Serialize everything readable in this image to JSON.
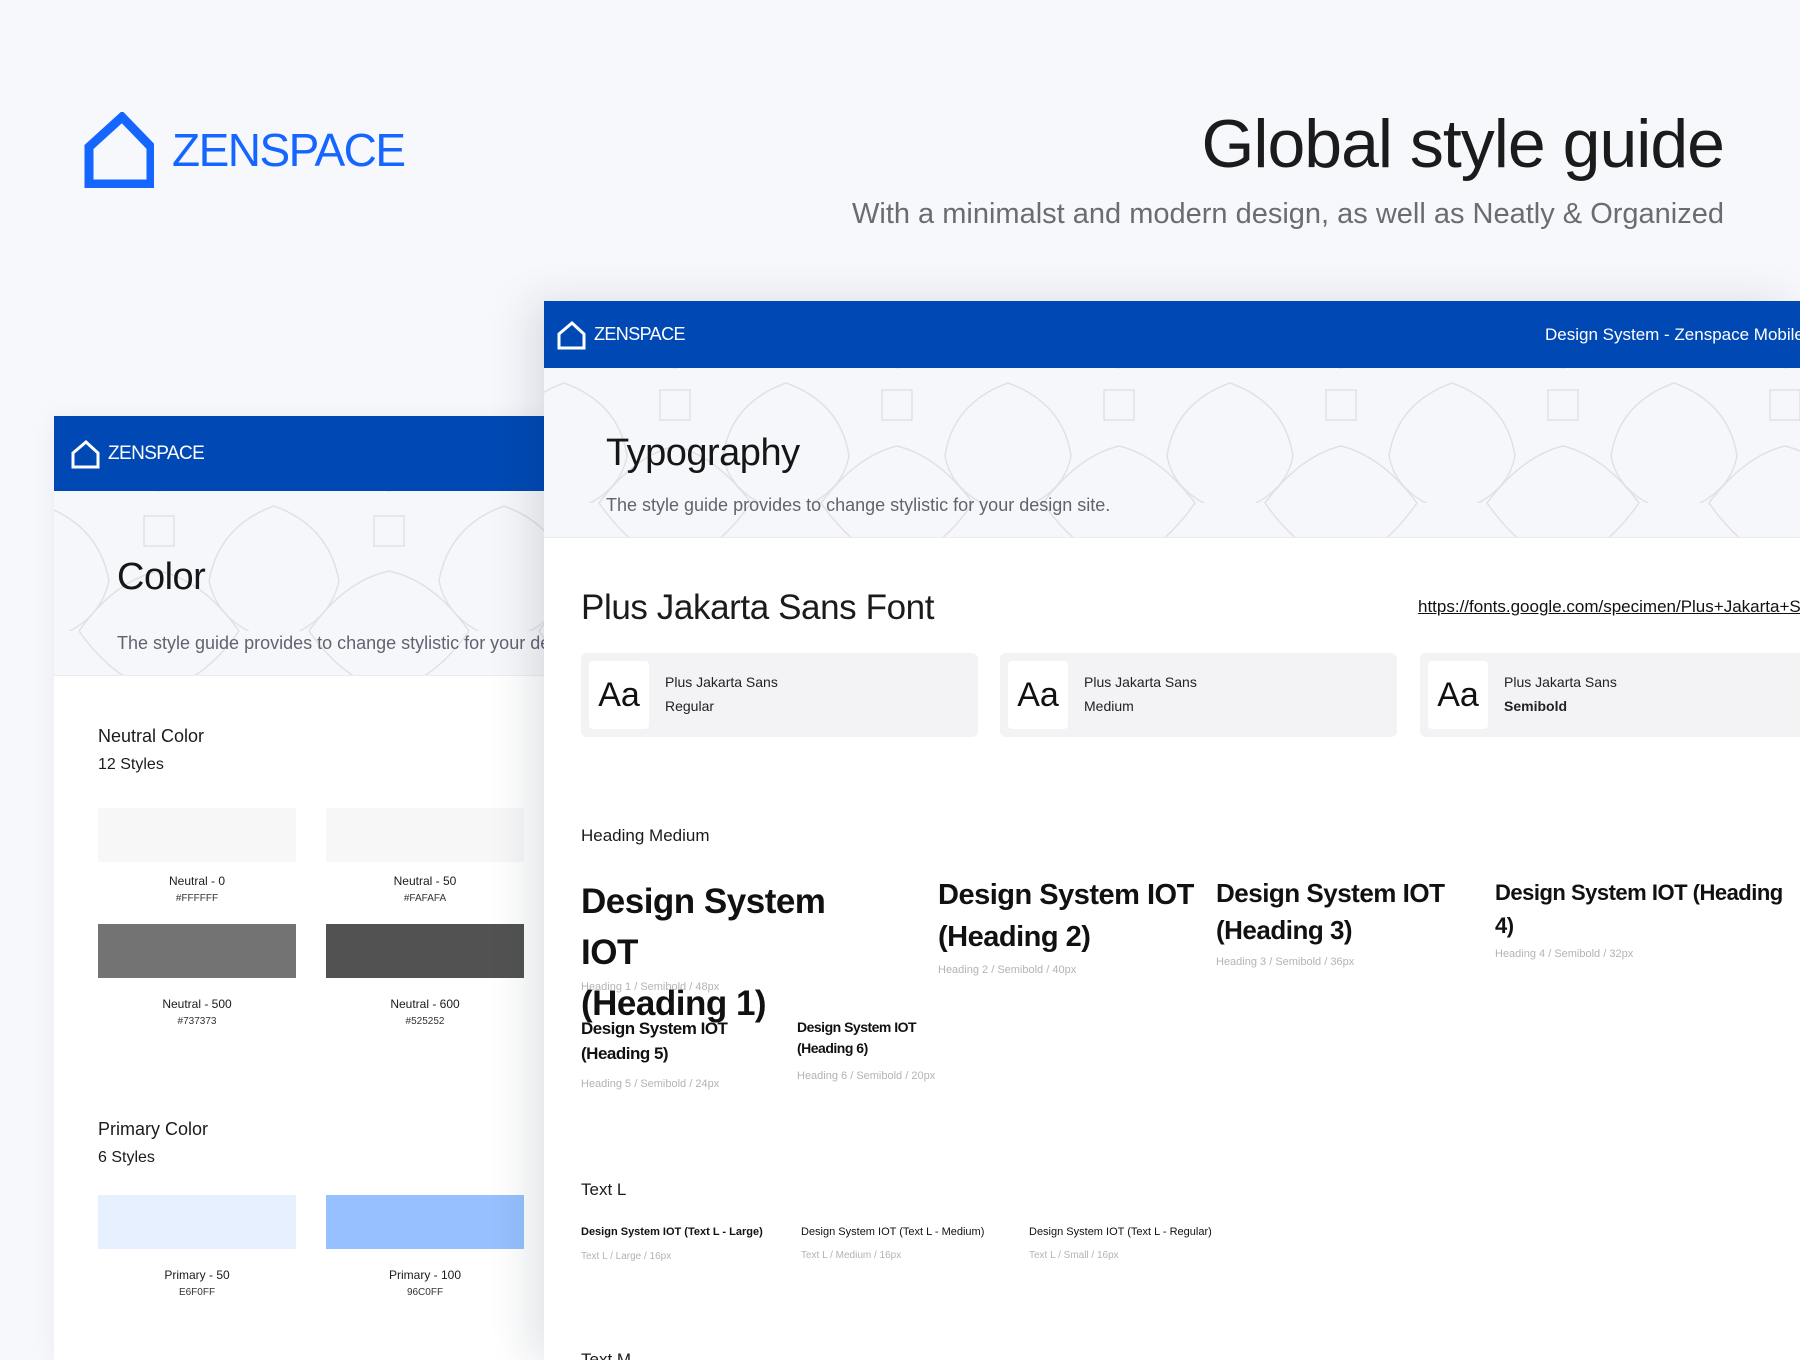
{
  "hero": {
    "brand": "ZENSPACE",
    "title": "Global style guide",
    "subtitle": "With a minimalst and modern design, as well as Neatly & Organized",
    "brand_color": "#1565ff"
  },
  "color_card": {
    "brand": "ZENSPACE",
    "title": "Color",
    "subtitle": "The style guide provides to change stylistic for your design site.",
    "neutral": {
      "title": "Neutral Color",
      "count": "12 Styles",
      "swatches": [
        {
          "name": "Neutral - 0",
          "hex": "#FFFFFF",
          "color": "#f7f7f8"
        },
        {
          "name": "Neutral - 50",
          "hex": "#FAFAFA",
          "color": "#f7f7f8"
        },
        {
          "name": "Neutral - 500",
          "hex": "#737373",
          "color": "#737373"
        },
        {
          "name": "Neutral - 600",
          "hex": "#525252",
          "color": "#525252"
        }
      ]
    },
    "primary": {
      "title": "Primary Color",
      "count": "6 Styles",
      "swatches": [
        {
          "name": "Primary - 50",
          "hex": "E6F0FF",
          "color": "#e6f0ff"
        },
        {
          "name": "Primary - 100",
          "hex": "96C0FF",
          "color": "#96c0ff"
        }
      ]
    }
  },
  "typo_card": {
    "brand": "ZENSPACE",
    "header_right": "Design System - Zenspace Mobile",
    "bar_color": "#0049b4",
    "title": "Typography",
    "subtitle": "The style guide provides to change stylistic for your design site.",
    "font_title": "Plus Jakarta Sans Font",
    "font_link": "https://fonts.google.com/specimen/Plus+Jakarta+Sans",
    "fonts": [
      {
        "aa": "Aa",
        "name": "Plus Jakarta Sans",
        "weight": "Regular"
      },
      {
        "aa": "Aa",
        "name": "Plus Jakarta Sans",
        "weight": "Medium"
      },
      {
        "aa": "Aa",
        "name": "Plus Jakarta Sans",
        "weight": "Semibold"
      }
    ],
    "heading_medium": {
      "label": "Heading Medium",
      "items": [
        {
          "line1": "Design System IOT",
          "line2": "(Heading 1)",
          "meta": "Heading 1 / Semibold / 48px"
        },
        {
          "line1": "Design System IOT",
          "line2": "(Heading 2)",
          "meta": "Heading 2 / Semibold / 40px"
        },
        {
          "line1": "Design System IOT",
          "line2": "(Heading 3)",
          "meta": "Heading 3 / Semibold / 36px"
        },
        {
          "line1": "Design System IOT (Heading",
          "line2": "4)",
          "meta": "Heading 4 / Semibold / 32px"
        },
        {
          "line1": "Design System IOT",
          "line2": "(Heading 5)",
          "meta": "Heading 5 / Semibold / 24px"
        },
        {
          "line1": "Design System IOT",
          "line2": "(Heading 6)",
          "meta": "Heading 6 / Semibold / 20px"
        }
      ]
    },
    "text_l": {
      "label": "Text L",
      "items": [
        {
          "text": "Design System IOT (Text L - Large)",
          "meta": "Text L / Large / 16px"
        },
        {
          "text": "Design System IOT (Text L - Medium)",
          "meta": "Text L / Medium / 16px"
        },
        {
          "text": "Design System IOT (Text L - Regular)",
          "meta": "Text L / Small / 16px"
        }
      ]
    },
    "text_m": {
      "label": "Text M"
    }
  }
}
